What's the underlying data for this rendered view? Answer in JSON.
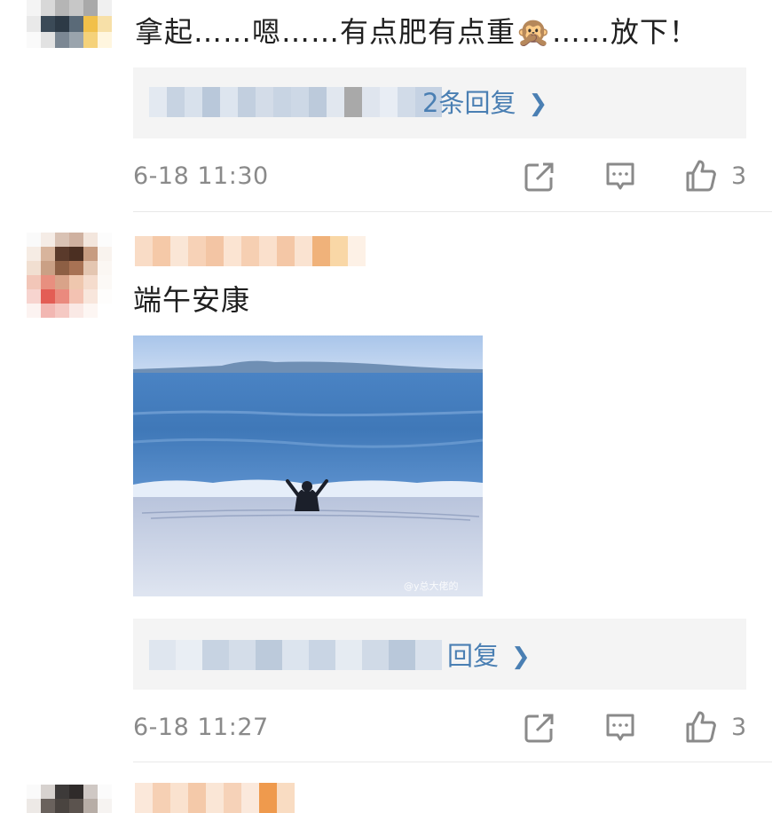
{
  "colors": {
    "link": "#4a7fb3",
    "meta_text": "#8a8a8a",
    "reply_bg": "#f4f4f4"
  },
  "comments": [
    {
      "text": "拿起……嗯……有点肥有点重🙊……放下！",
      "reply_link": "共2条回复",
      "reply_visible_part": "2条回复",
      "time": "6-18 11:30",
      "likes": "3"
    },
    {
      "text": "端午安康",
      "image_alt": "seaside-photo",
      "image_watermark": "@y总大佬的",
      "reply_link": "回复",
      "time": "6-18 11:27",
      "likes": "3"
    }
  ],
  "icons": {
    "share": "share-icon",
    "comment": "comment-icon",
    "like": "thumbs-up-icon",
    "chevron": "chevron-right-icon"
  }
}
